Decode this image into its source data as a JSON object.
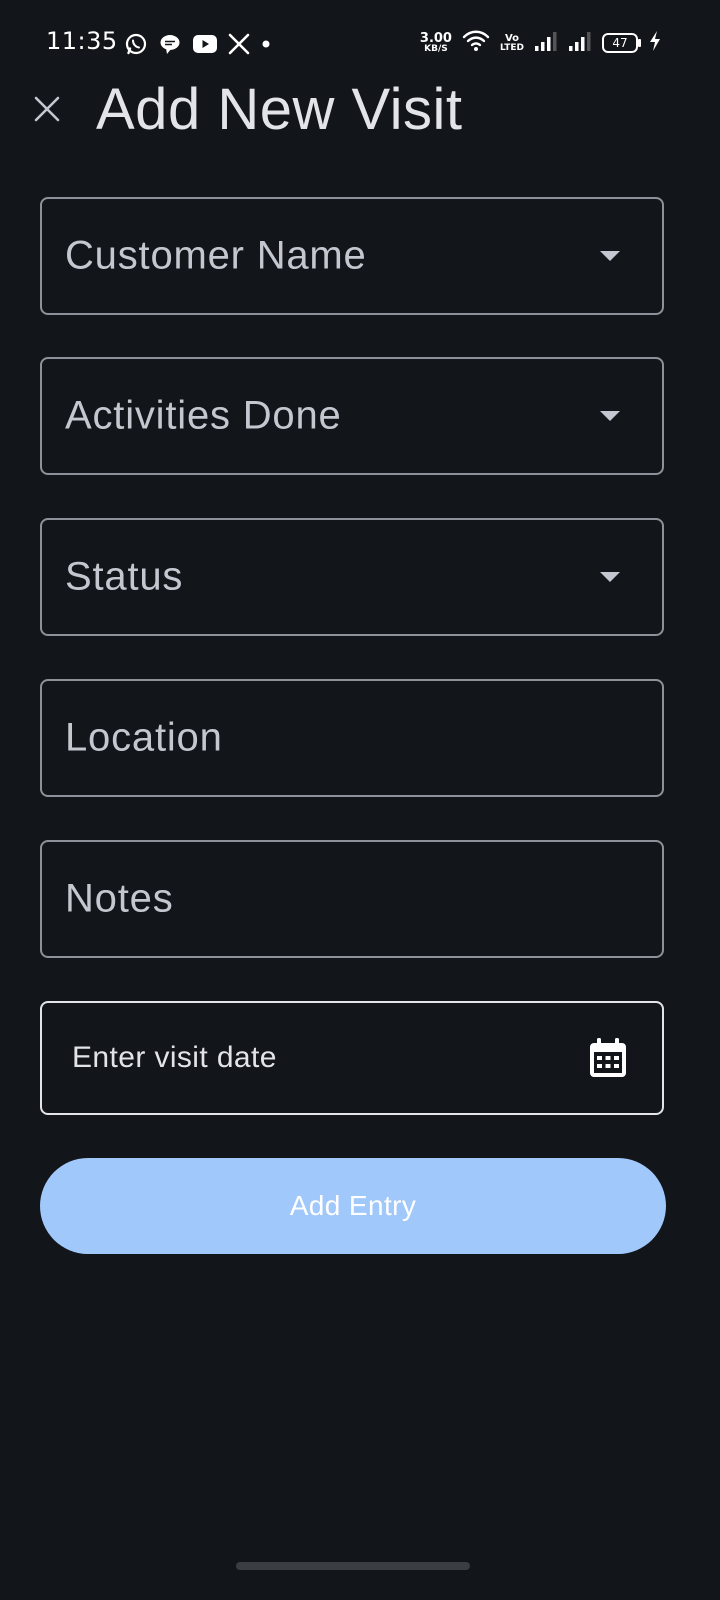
{
  "status_bar": {
    "time": "11:35",
    "net_speed_value": "3.00",
    "net_speed_unit": "KB/S",
    "volte_top": "Vo",
    "volte_bottom": "LTED",
    "battery_level": "47",
    "notification_icons": [
      "whatsapp-icon",
      "chat-bubble-icon",
      "youtube-icon",
      "x-icon",
      "dot-icon"
    ],
    "system_icons": [
      "wifi-icon",
      "signal-icon",
      "signal-icon",
      "battery-icon",
      "charging-icon"
    ]
  },
  "header": {
    "title": "Add New Visit",
    "close_icon": "close-icon"
  },
  "form": {
    "customer_name_label": "Customer Name",
    "activities_label": "Activities Done",
    "status_label": "Status",
    "location_label": "Location",
    "notes_label": "Notes",
    "visit_date_value": "Enter visit date",
    "calendar_icon": "calendar-icon",
    "dropdown_icon": "dropdown-arrow-icon"
  },
  "actions": {
    "add_entry_label": "Add Entry"
  },
  "colors": {
    "background": "#121519",
    "text_primary": "#e2e4ea",
    "text_secondary": "#c4c7d0",
    "field_border": "#8e9199",
    "button_bg": "#a1c8fb",
    "button_text": "#ffffff"
  }
}
